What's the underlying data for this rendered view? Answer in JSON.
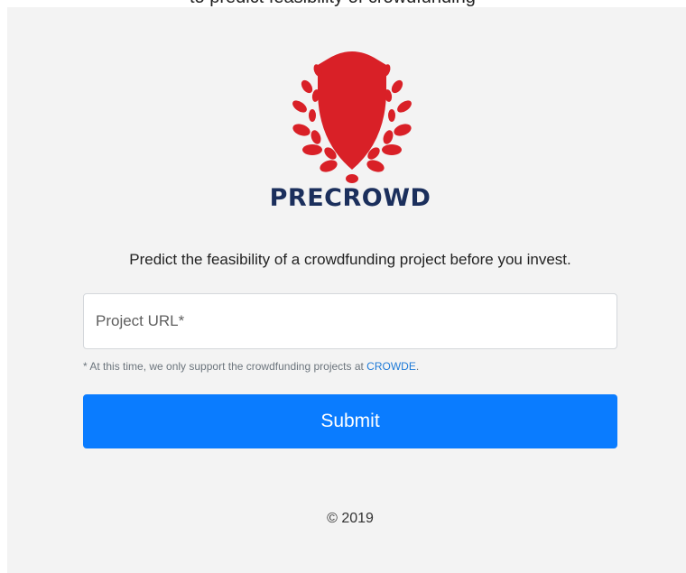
{
  "header_fragment": "to predict feasibility of crowdfunding",
  "brand": {
    "name": "PRECROWD",
    "logo_icon": "shield-laurel-icon",
    "logo_color": "#d92027",
    "name_color": "#1b2f5c"
  },
  "tagline": "Predict the feasibility of a crowdfunding project before you invest.",
  "form": {
    "url_placeholder": "Project URL*",
    "url_value": "",
    "note_prefix": "* At this time, we only support the crowdfunding projects at ",
    "note_link": "CROWDE",
    "note_suffix": ".",
    "submit_label": "Submit",
    "submit_color": "#0a7cff"
  },
  "footer": {
    "copyright": "© 2019"
  }
}
